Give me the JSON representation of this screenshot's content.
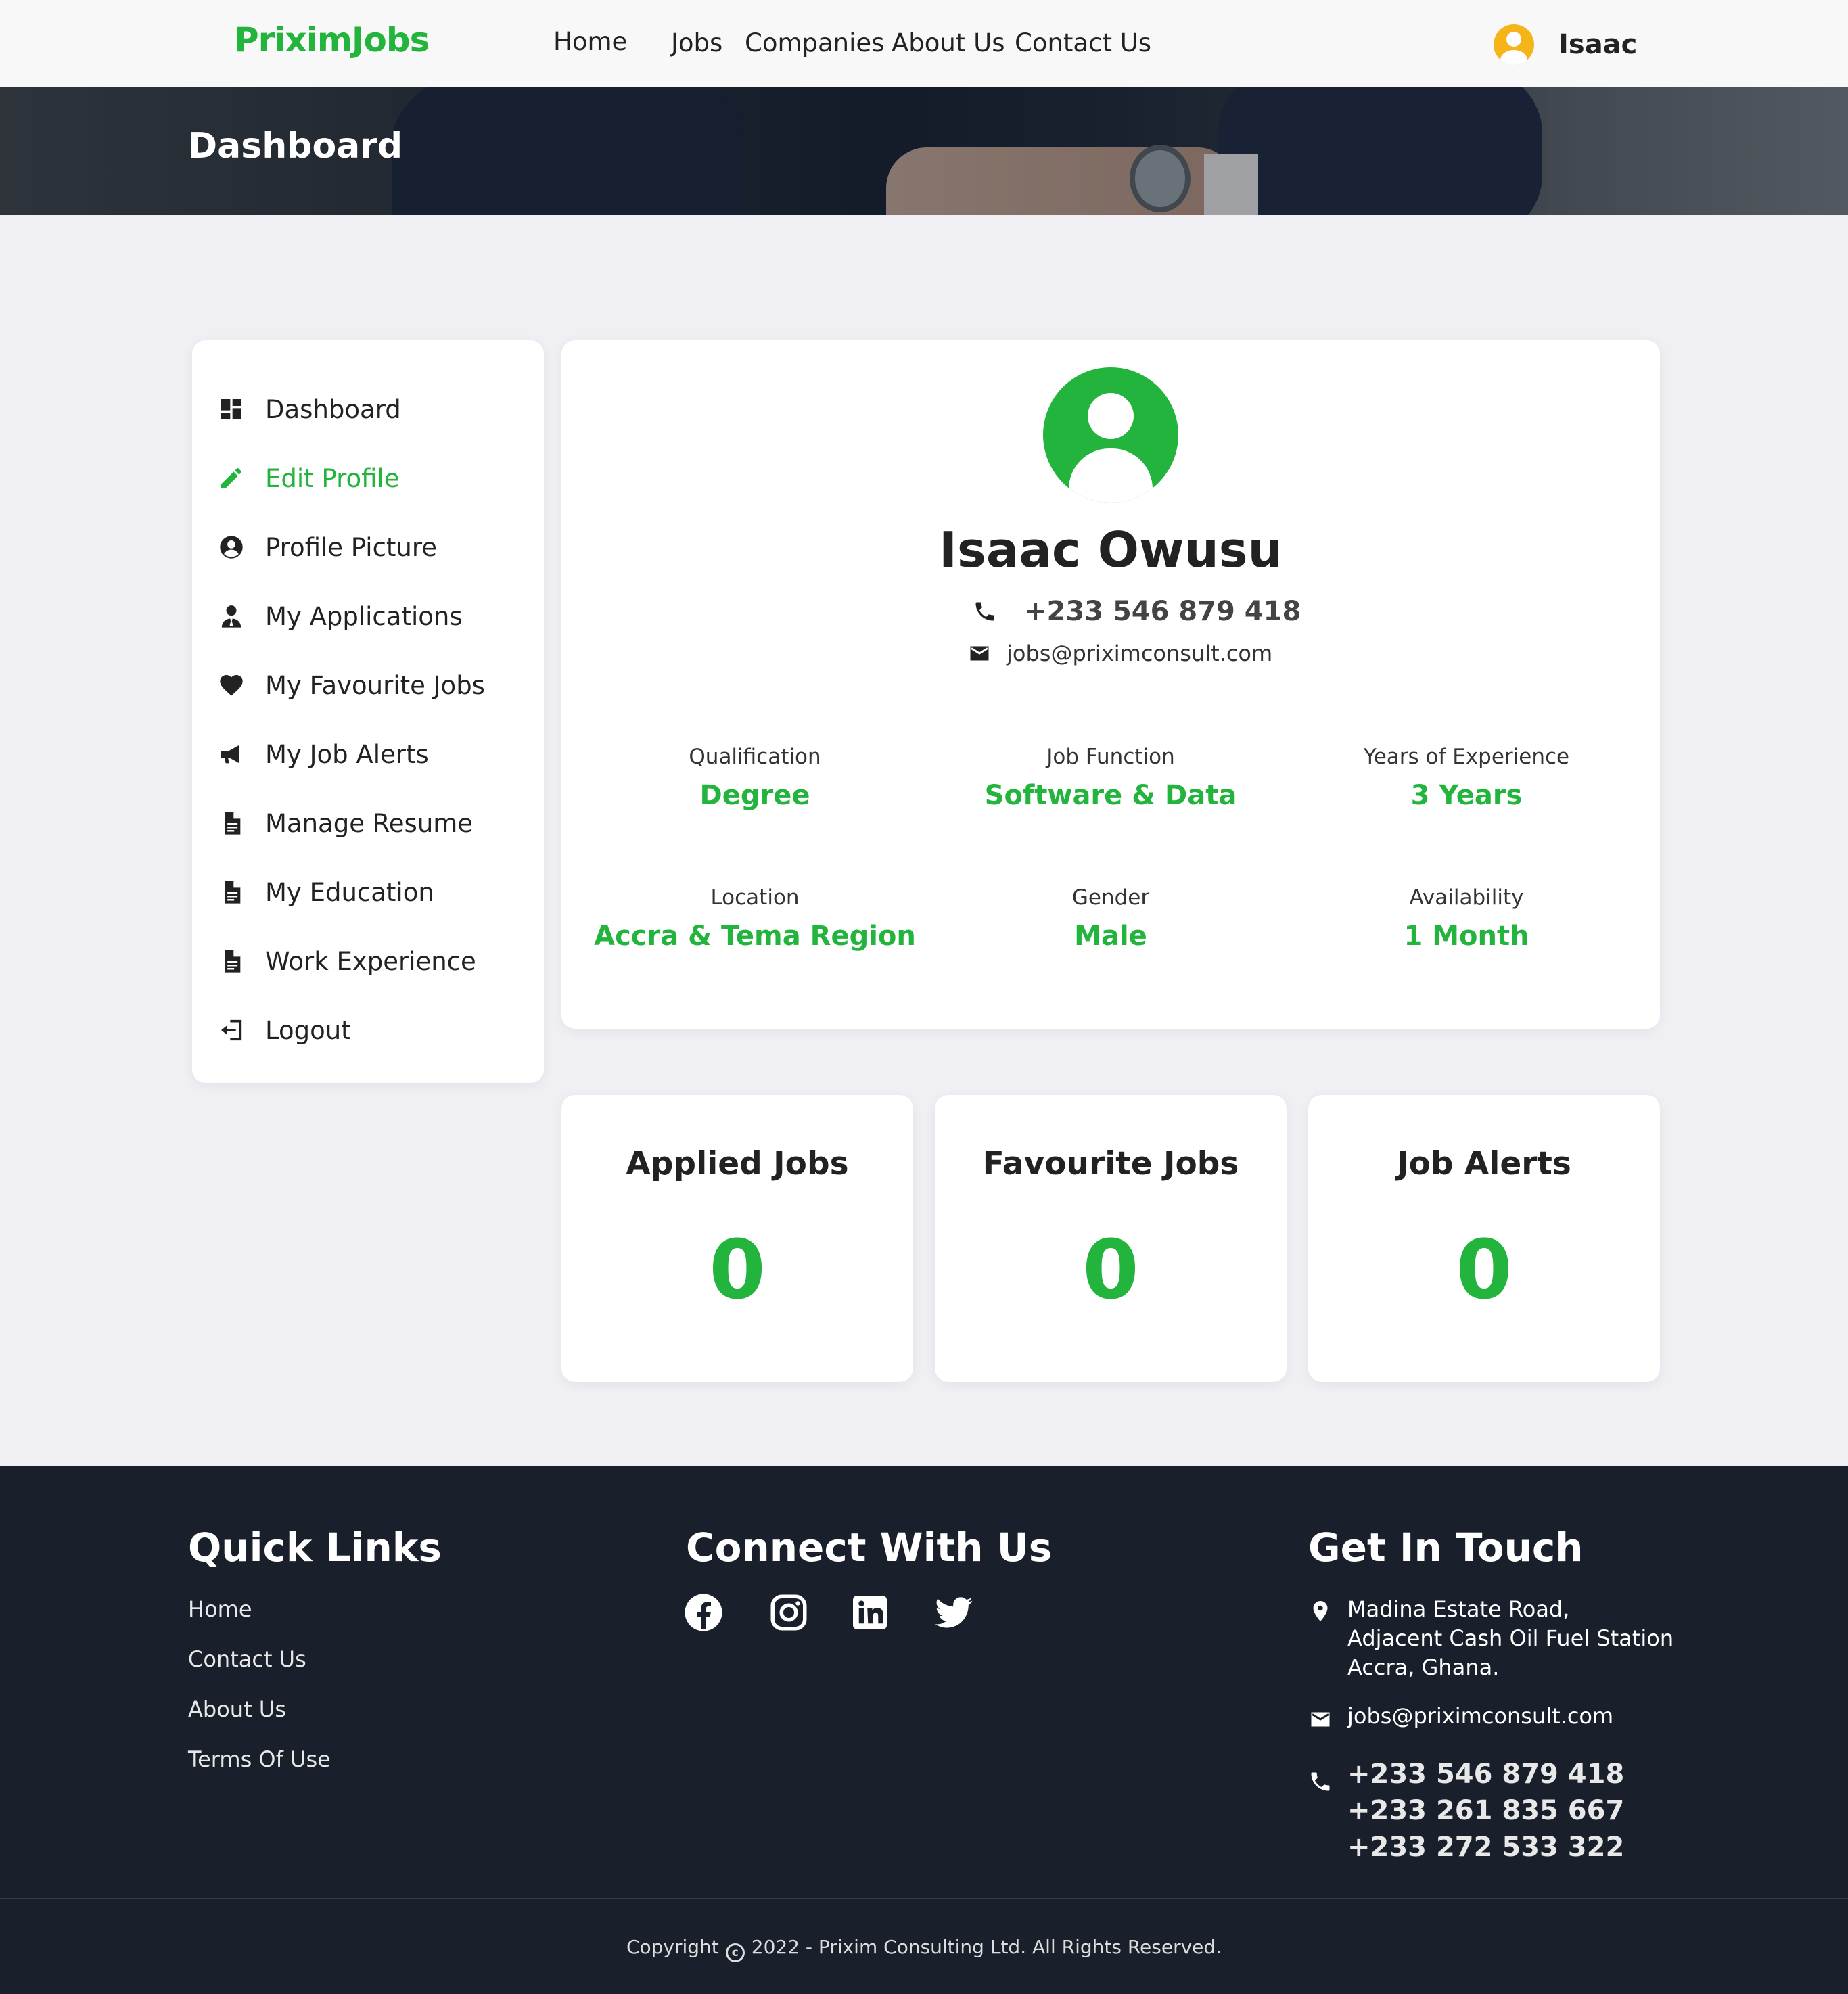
{
  "header": {
    "logo": "PriximJobs",
    "nav": {
      "home": "Home",
      "jobs": "Jobs",
      "companies": "Companies",
      "about": "About Us",
      "contact": "Contact Us"
    },
    "user_name": "Isaac"
  },
  "banner": {
    "title": "Dashboard"
  },
  "sidebar": {
    "items": [
      {
        "label": "Dashboard",
        "icon": "dashboard-icon"
      },
      {
        "label": "Edit Profile",
        "icon": "pencil-icon",
        "active": true
      },
      {
        "label": "Profile Picture",
        "icon": "user-circle-icon"
      },
      {
        "label": "My Applications",
        "icon": "user-tie-icon"
      },
      {
        "label": "My Favourite Jobs",
        "icon": "heart-icon"
      },
      {
        "label": "My Job Alerts",
        "icon": "megaphone-icon"
      },
      {
        "label": "Manage Resume",
        "icon": "document-icon"
      },
      {
        "label": "My Education",
        "icon": "document-icon"
      },
      {
        "label": "Work Experience",
        "icon": "document-icon"
      },
      {
        "label": "Logout",
        "icon": "logout-icon"
      }
    ]
  },
  "profile": {
    "name": "Isaac Owusu",
    "phone": "+233 546 879 418",
    "email": "jobs@priximconsult.com",
    "stats": {
      "qualification": {
        "label": "Qualification",
        "value": "Degree"
      },
      "job_function": {
        "label": "Job Function",
        "value": "Software & Data"
      },
      "experience": {
        "label": "Years of Experience",
        "value": "3 Years"
      },
      "location": {
        "label": "Location",
        "value": "Accra & Tema Region"
      },
      "gender": {
        "label": "Gender",
        "value": "Male"
      },
      "availability": {
        "label": "Availability",
        "value": "1 Month"
      }
    }
  },
  "counts": {
    "applied": {
      "title": "Applied Jobs",
      "value": "0"
    },
    "favourite": {
      "title": "Favourite Jobs",
      "value": "0"
    },
    "alerts": {
      "title": "Job Alerts",
      "value": "0"
    }
  },
  "footer": {
    "quick_links": {
      "heading": "Quick Links",
      "items": [
        "Home",
        "Contact Us",
        "About Us",
        "Terms Of Use"
      ]
    },
    "connect": {
      "heading": "Connect With Us",
      "icons": [
        "facebook-icon",
        "instagram-icon",
        "linkedin-icon",
        "twitter-icon"
      ]
    },
    "touch": {
      "heading": "Get In Touch",
      "address": [
        "Madina Estate Road,",
        "Adjacent Cash Oil Fuel Station",
        "Accra, Ghana."
      ],
      "email": "jobs@priximconsult.com",
      "phones": [
        "+233 546 879 418",
        "+233 261 835 667",
        "+233 272 533 322"
      ]
    },
    "copyright_prefix": "Copyright",
    "copyright_text": "2022 - Prixim Consulting Ltd. All Rights Reserved."
  },
  "colors": {
    "brand_green": "#22b43c",
    "avatar_orange": "#f4b41a",
    "footer_bg": "#1a202b",
    "page_bg": "#f0f0f4"
  }
}
